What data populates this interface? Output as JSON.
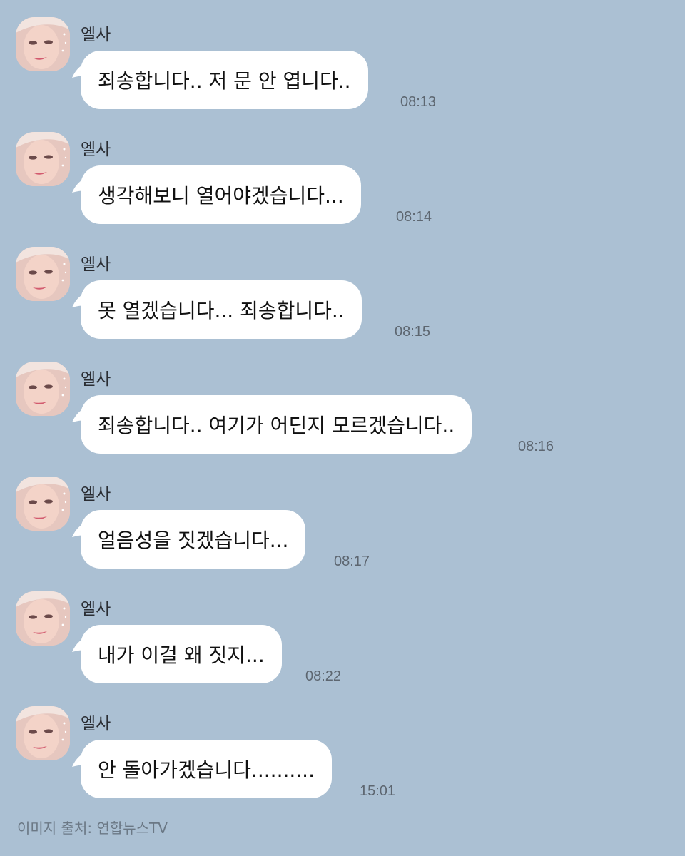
{
  "contact": {
    "name": "엘사"
  },
  "messages": [
    {
      "text": "죄송합니다.. 저 문 안 엽니다..",
      "time": "08:13"
    },
    {
      "text": "생각해보니 열어야겠습니다...",
      "time": "08:14"
    },
    {
      "text": "못 열겠습니다... 죄송합니다..",
      "time": "08:15"
    },
    {
      "text": "죄송합니다.. 여기가 어딘지 모르겠습니다..",
      "time": "08:16"
    },
    {
      "text": "얼음성을 짓겠습니다...",
      "time": "08:17"
    },
    {
      "text": "내가 이걸 왜 짓지...",
      "time": "08:22"
    },
    {
      "text": "안 돌아가겠습니다..........",
      "time": "15:01"
    }
  ],
  "footer": {
    "credit": "이미지 출처: 연합뉴스TV"
  },
  "colors": {
    "background": "#abc0d3",
    "bubble": "#ffffff",
    "text": "#111111",
    "timestamp": "#5d6670"
  }
}
